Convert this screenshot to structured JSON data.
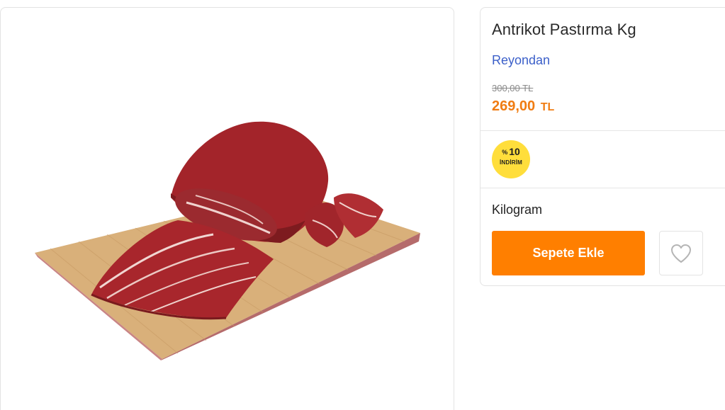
{
  "product": {
    "image_alt": "Antrikot Pastırma Kg",
    "title": "Antrikot Pastırma Kg",
    "store_label": "Reyondan",
    "old_price": "300,00 TL",
    "price_amount": "269,00",
    "price_currency": "TL",
    "discount": {
      "percent_symbol": "%",
      "value": "10",
      "label": "İNDİRİM"
    },
    "unit_label": "Kilogram",
    "add_to_cart_label": "Sepete Ekle",
    "favorite_icon": "heart-icon"
  },
  "colors": {
    "accent_orange": "#ff7f00",
    "price_orange": "#f07c12",
    "link_blue": "#3b5fc9",
    "badge_yellow": "#ffde3b"
  }
}
